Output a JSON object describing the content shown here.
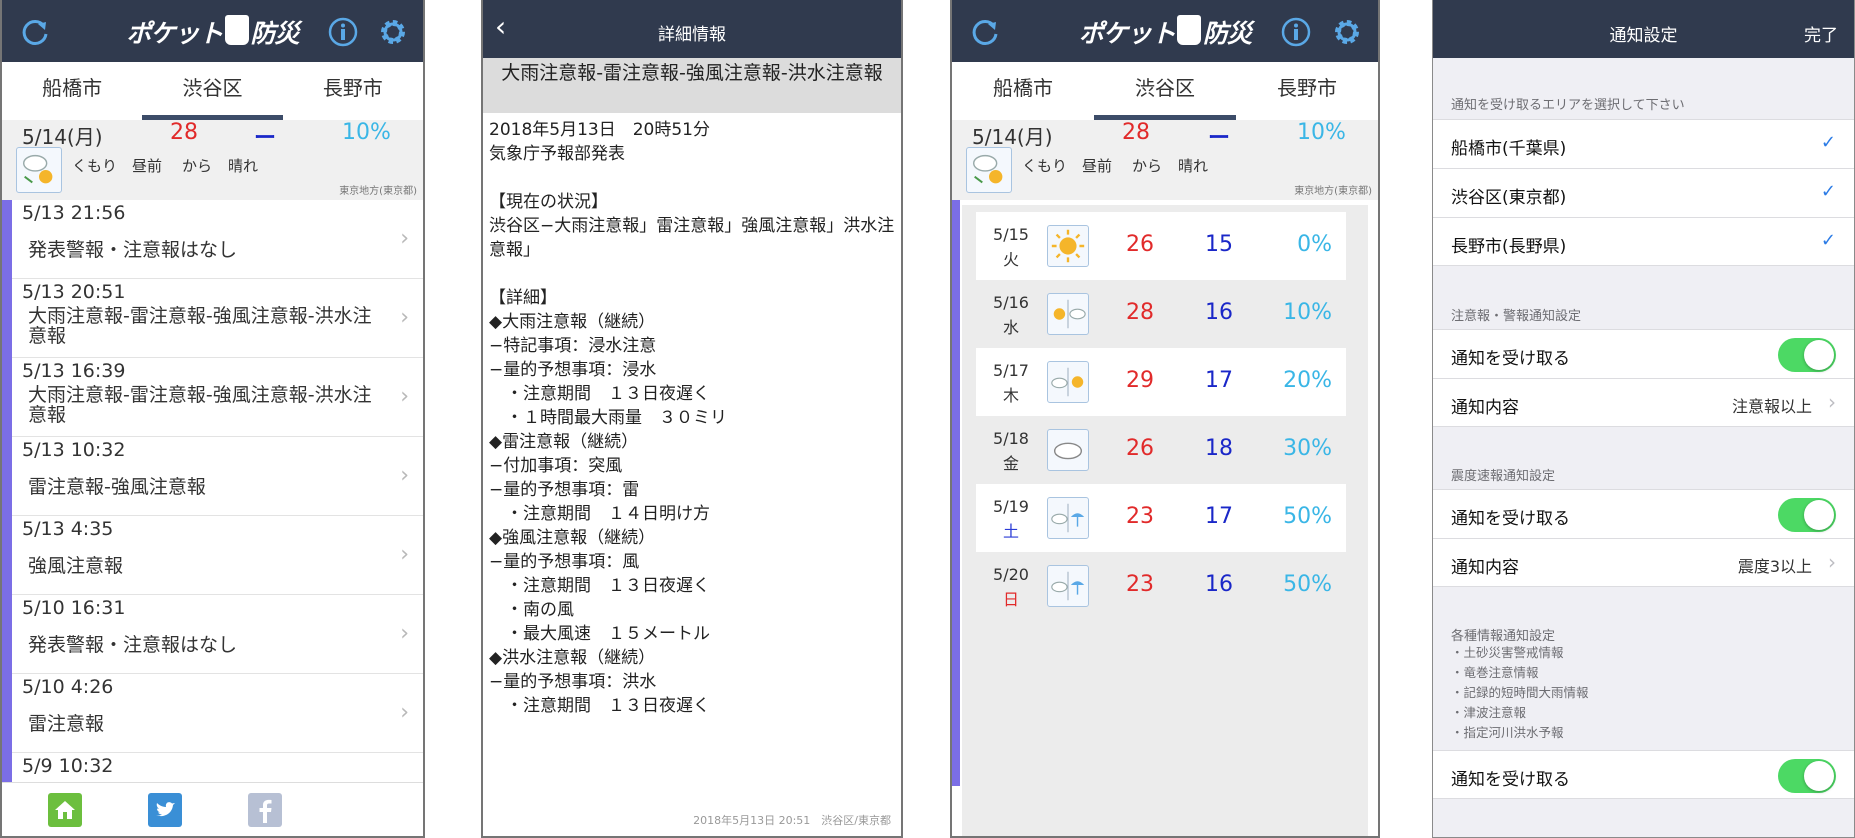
{
  "app": {
    "logo_text_left": "ポケット",
    "logo_text_right": "防災",
    "colors": {
      "header": "#303a4e",
      "accent_bar": "#7b6ee6",
      "temp_high": "#e12a2a",
      "temp_low": "#1a27c8",
      "precip": "#3ab6e6",
      "toggle_on": "#4cd964"
    }
  },
  "screen1": {
    "tabs": [
      {
        "label": "船橋市"
      },
      {
        "label": "渋谷区"
      },
      {
        "label": "長野市"
      }
    ],
    "today": {
      "date": "5/14(月)",
      "high": "28",
      "low": "ー",
      "precip": "10%",
      "desc": [
        "くもり",
        "昼前",
        "から",
        "晴れ"
      ],
      "source": "東京地方(東京都)"
    },
    "alerts": [
      {
        "time": "5/13 21:56",
        "text": "発表警報・注意報はなし"
      },
      {
        "time": "5/13 20:51",
        "text": "大雨注意報-雷注意報-強風注意報-洪水注意報"
      },
      {
        "time": "5/13 16:39",
        "text": "大雨注意報-雷注意報-強風注意報-洪水注意報"
      },
      {
        "time": "5/13 10:32",
        "text": "雷注意報-強風注意報"
      },
      {
        "time": "5/13 4:35",
        "text": "強風注意報"
      },
      {
        "time": "5/10 16:31",
        "text": "発表警報・注意報はなし"
      },
      {
        "time": "5/10 4:26",
        "text": "雷注意報"
      },
      {
        "time": "5/9 10:32",
        "text": ""
      }
    ],
    "icons": {
      "refresh": "refresh-icon",
      "info": "info-icon",
      "settings": "gear-icon",
      "home": "home-icon",
      "twitter": "twitter-icon",
      "facebook": "facebook-icon"
    }
  },
  "screen2": {
    "title": "詳細情報",
    "headline": "大雨注意報-雷注意報-強風注意報-洪水注意報",
    "body": "2018年5月13日　20時51分\n気象庁予報部発表\n\n【現在の状況】\n渋谷区−大雨注意報」雷注意報」強風注意報」洪水注意報」\n\n【詳細】\n◆大雨注意報（継続）\n−特記事項：浸水注意\n−量的予想事項：浸水\n　・注意期間　１３日夜遅く\n　・１時間最大雨量　３０ミリ\n◆雷注意報（継続）\n−付加事項：突風\n−量的予想事項：雷\n　・注意期間　１４日明け方\n◆強風注意報（継続）\n−量的予想事項：風\n　・注意期間　１３日夜遅く\n　・南の風\n　・最大風速　１５メートル\n◆洪水注意報（継続）\n−量的予想事項：洪水\n　・注意期間　１３日夜遅く",
    "footer": "2018年5月13日 20:51　渋谷区/東京都"
  },
  "screen3": {
    "tabs": [
      {
        "label": "船橋市"
      },
      {
        "label": "渋谷区"
      },
      {
        "label": "長野市"
      }
    ],
    "today": {
      "date": "5/14(月)",
      "high": "28",
      "low": "ー",
      "precip": "10%",
      "desc": [
        "くもり",
        "昼前",
        "から",
        "晴れ"
      ],
      "source": "東京地方(東京都)"
    },
    "week": [
      {
        "date": "5/15",
        "dow": "火",
        "dow_color": "#333333",
        "icon": "sunny-icon",
        "high": "26",
        "low": "15",
        "precip": "0%"
      },
      {
        "date": "5/16",
        "dow": "水",
        "dow_color": "#333333",
        "icon": "sun-then-cloud-icon",
        "high": "28",
        "low": "16",
        "precip": "10%"
      },
      {
        "date": "5/17",
        "dow": "木",
        "dow_color": "#333333",
        "icon": "cloud-then-sun-icon",
        "high": "29",
        "low": "17",
        "precip": "20%"
      },
      {
        "date": "5/18",
        "dow": "金",
        "dow_color": "#333333",
        "icon": "cloudy-icon",
        "high": "26",
        "low": "18",
        "precip": "30%"
      },
      {
        "date": "5/19",
        "dow": "土",
        "dow_color": "#2a3bd6",
        "icon": "cloud-then-rain-icon",
        "high": "23",
        "low": "17",
        "precip": "50%"
      },
      {
        "date": "5/20",
        "dow": "日",
        "dow_color": "#e12a2a",
        "icon": "cloud-then-rain-icon",
        "high": "23",
        "low": "16",
        "precip": "50%"
      }
    ]
  },
  "screen4": {
    "title": "通知設定",
    "done": "完了",
    "area_header": "通知を受け取るエリアを選択して下さい",
    "areas": [
      {
        "label": "船橋市(千葉県)",
        "checked": true
      },
      {
        "label": "渋谷区(東京都)",
        "checked": true
      },
      {
        "label": "長野市(長野県)",
        "checked": true
      }
    ],
    "warning_header": "注意報・警報通知設定",
    "warning_receive": "通知を受け取る",
    "warning_content_label": "通知内容",
    "warning_content_value": "注意報以上",
    "quake_header": "震度速報通知設定",
    "quake_receive": "通知を受け取る",
    "quake_content_label": "通知内容",
    "quake_content_value": "震度3以上",
    "info_header": "各種情報通知設定",
    "info_items": [
      "・土砂災害警戒情報",
      "・竜巻注意情報",
      "・記録的短時間大雨情報",
      "・津波注意報",
      "・指定河川洪水予報"
    ],
    "info_receive": "通知を受け取る",
    "check_mark": "✓"
  }
}
